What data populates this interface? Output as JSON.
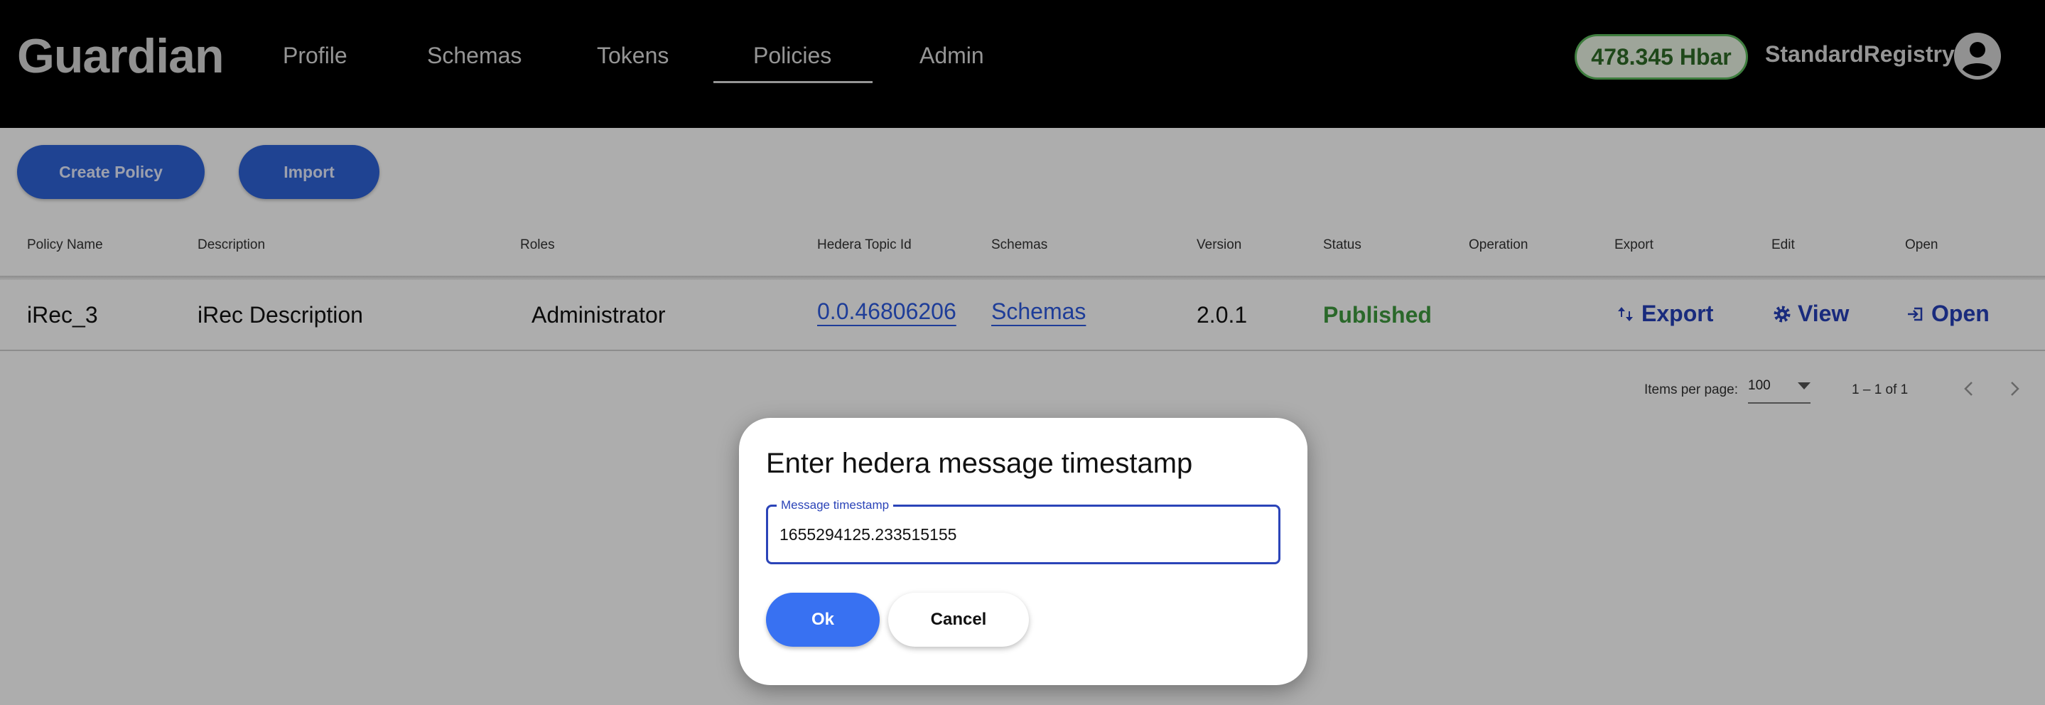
{
  "header": {
    "logo": "Guardian",
    "nav": [
      {
        "label": "Profile",
        "active": false
      },
      {
        "label": "Schemas",
        "active": false
      },
      {
        "label": "Tokens",
        "active": false
      },
      {
        "label": "Policies",
        "active": true
      },
      {
        "label": "Admin",
        "active": false
      }
    ],
    "balance": "478.345 Hbar",
    "username": "StandardRegistry",
    "avatar_icon": "account-circle-icon"
  },
  "toolbar": {
    "create_label": "Create Policy",
    "import_label": "Import"
  },
  "table": {
    "columns": [
      "Policy Name",
      "Description",
      "Roles",
      "Hedera Topic Id",
      "Schemas",
      "Version",
      "Status",
      "Operation",
      "Export",
      "Edit",
      "Open"
    ],
    "rows": [
      {
        "name": "iRec_3",
        "description": "iRec Description",
        "roles": "Administrator",
        "topic_id": "0.0.46806206",
        "schemas": "Schemas",
        "version": "2.0.1",
        "status": "Published",
        "operation": "",
        "export": "Export",
        "edit": "View",
        "open": "Open"
      }
    ]
  },
  "paginator": {
    "items_per_page_label": "Items per page:",
    "items_per_page": "100",
    "range": "1 – 1 of 1"
  },
  "dialog": {
    "title": "Enter hedera message timestamp",
    "field_label": "Message timestamp",
    "field_value": "1655294125.233515155",
    "ok_label": "Ok",
    "cancel_label": "Cancel"
  },
  "colors": {
    "primary": "#2f64d8",
    "ok_button": "#3871f2",
    "status_published": "#3f9a3f",
    "link": "#2d5ae0",
    "header_bg": "#000000"
  }
}
